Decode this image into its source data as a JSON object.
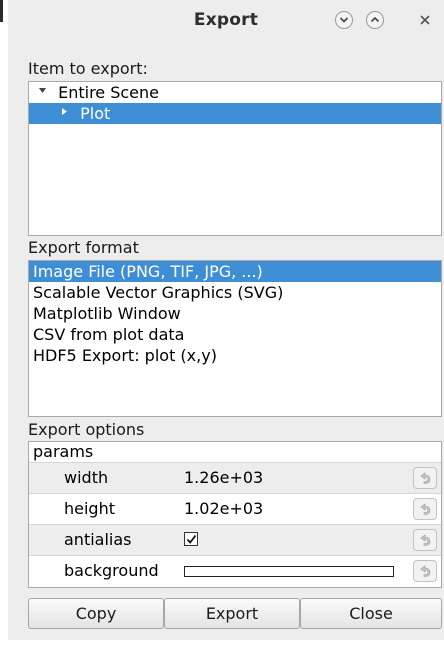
{
  "window": {
    "title": "Export"
  },
  "item_section": {
    "label": "Item to export:",
    "tree": [
      {
        "label": "Entire Scene",
        "expanded": true,
        "selected": false
      },
      {
        "label": "Plot",
        "expanded": false,
        "selected": true
      }
    ]
  },
  "format_section": {
    "label": "Export format",
    "formats": [
      {
        "label": "Image File (PNG, TIF, JPG, ...)",
        "selected": true
      },
      {
        "label": "Scalable Vector Graphics (SVG)",
        "selected": false
      },
      {
        "label": "Matplotlib Window",
        "selected": false
      },
      {
        "label": "CSV from plot data",
        "selected": false
      },
      {
        "label": "HDF5 Export: plot (x,y)",
        "selected": false
      }
    ]
  },
  "options_section": {
    "label": "Export options",
    "group": "params",
    "params": [
      {
        "name": "width",
        "value": "1.26e+03"
      },
      {
        "name": "height",
        "value": "1.02e+03"
      },
      {
        "name": "antialias",
        "checked": true
      },
      {
        "name": "background",
        "color": "#ffffff"
      }
    ]
  },
  "buttons": {
    "copy": "Copy",
    "export": "Export",
    "close": "Close"
  },
  "colors": {
    "selection": "#3e8ed6",
    "window_bg": "#ededed"
  }
}
